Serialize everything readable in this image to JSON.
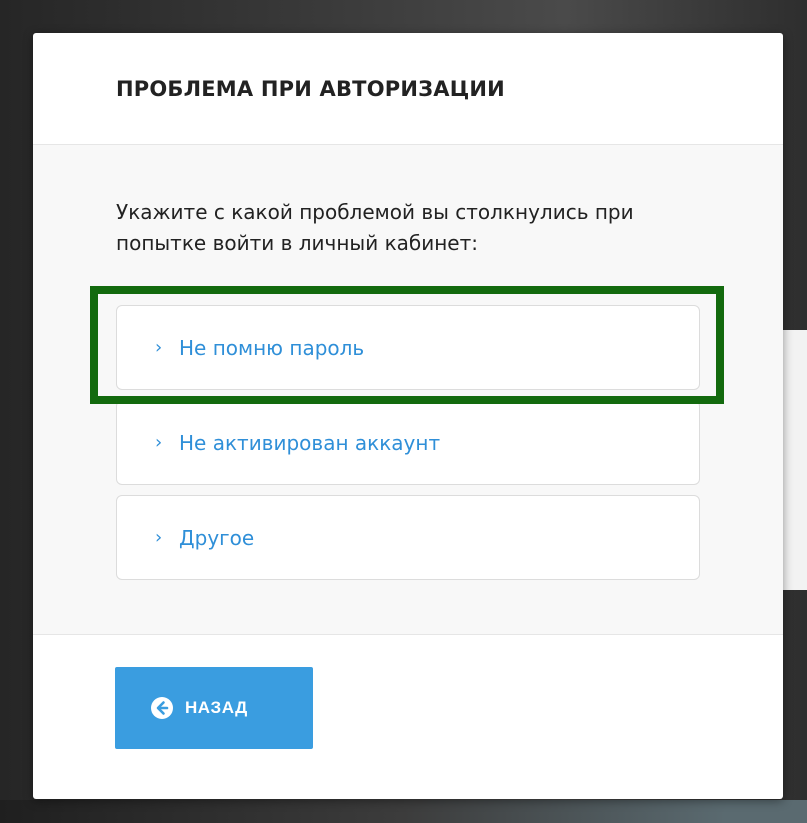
{
  "modal": {
    "title": "ПРОБЛЕМА ПРИ АВТОРИЗАЦИИ",
    "prompt": "Укажите с какой проблемой вы столкнулись при попытке войти в личный кабинет:",
    "options": [
      {
        "label": "Не помню пароль",
        "highlighted": true
      },
      {
        "label": "Не активирован аккаунт",
        "highlighted": false
      },
      {
        "label": "Другое",
        "highlighted": false
      }
    ],
    "back_button": {
      "label": "НАЗАД",
      "icon": "arrow-left-circle-icon"
    }
  },
  "colors": {
    "accent": "#2f8fd8",
    "button": "#3a9de0",
    "highlight": "#136a0e"
  }
}
